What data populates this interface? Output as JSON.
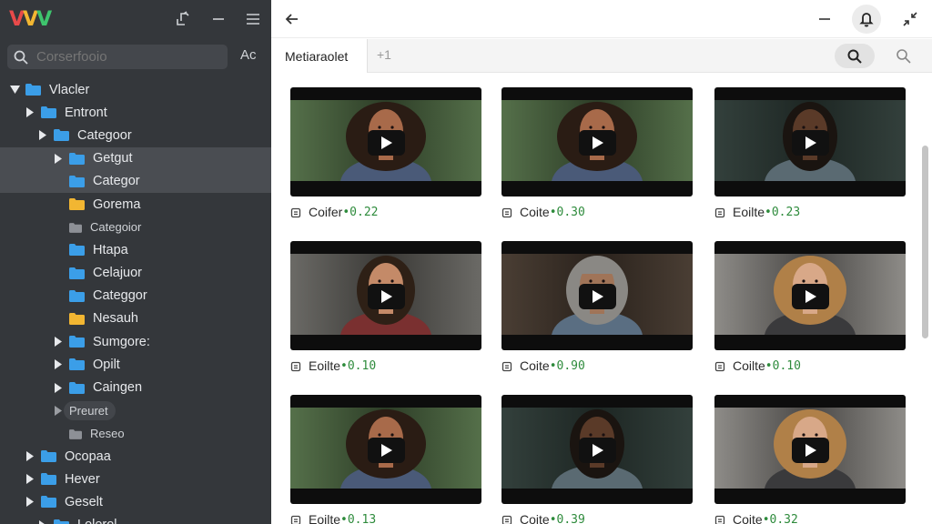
{
  "sidebar": {
    "logo": "VVV",
    "search": {
      "placeholder": "Corserfooio"
    },
    "case_toggle": "Ac",
    "tree": [
      {
        "label": "Vlacler",
        "level": 0,
        "caret": "down",
        "folder": "blue"
      },
      {
        "label": "Entront",
        "level": 1,
        "caret": "right",
        "folder": "blue"
      },
      {
        "label": "Categoor",
        "level": 2,
        "caret": "right",
        "folder": "blue"
      },
      {
        "label": "Getgut",
        "level": 3,
        "caret": "right",
        "folder": "blue",
        "selected": true
      },
      {
        "label": "Categor",
        "level": 3,
        "caret": "none",
        "folder": "blue",
        "selected": true
      },
      {
        "label": "Gorema",
        "level": 3,
        "caret": "none",
        "folder": "yellow"
      },
      {
        "label": "Categoior",
        "level": 3,
        "caret": "none",
        "folder": "gray",
        "small": true
      },
      {
        "label": "Htapa",
        "level": 3,
        "caret": "none",
        "folder": "blue"
      },
      {
        "label": "Celajuor",
        "level": 3,
        "caret": "none",
        "folder": "blue"
      },
      {
        "label": "Categgor",
        "level": 3,
        "caret": "none",
        "folder": "blue"
      },
      {
        "label": "Nesauh",
        "level": 3,
        "caret": "none",
        "folder": "yellow"
      },
      {
        "label": "Sumgore:",
        "level": 3,
        "caret": "right",
        "folder": "blue"
      },
      {
        "label": "Opilt",
        "level": 3,
        "caret": "right",
        "folder": "blue"
      },
      {
        "label": "Caingen",
        "level": 3,
        "caret": "right",
        "folder": "blue"
      },
      {
        "label": "Preuret",
        "level": 3,
        "caret": "right-gray",
        "folder": "none",
        "small": true,
        "pill": true
      },
      {
        "label": "Reseo",
        "level": 3,
        "caret": "none",
        "folder": "gray",
        "small": true
      },
      {
        "label": "Ocopaa",
        "level": 1,
        "caret": "right",
        "folder": "blue"
      },
      {
        "label": "Hever",
        "level": 1,
        "caret": "right",
        "folder": "blue"
      },
      {
        "label": "Geselt",
        "level": 1,
        "caret": "right",
        "folder": "blue"
      },
      {
        "label": "Lolerol",
        "level": 2,
        "caret": "right",
        "folder": "blue"
      }
    ]
  },
  "main": {
    "tab": {
      "label": "Metiaraolet",
      "add_label": "+1"
    },
    "icons": {
      "back": "arrow-left-icon",
      "minimize": "minus-icon",
      "notifications": "bell-icon",
      "collapse": "collapse-arrows-icon",
      "search": "search-icon",
      "person": "person-icon"
    },
    "videos": [
      {
        "label": "Coifer",
        "value": "0.22",
        "scene": "curly-woman"
      },
      {
        "label": "Coite",
        "value": "0.30",
        "scene": "curly-woman"
      },
      {
        "label": "Eoilte",
        "value": "0.23",
        "scene": "bearded-man-dark"
      },
      {
        "label": "Eoilte",
        "value": "0.10",
        "scene": "young-man"
      },
      {
        "label": "Coite",
        "value": "0.90",
        "scene": "beanie-man"
      },
      {
        "label": "Coilte",
        "value": "0.10",
        "scene": "blonde-woman"
      },
      {
        "label": "Eoilte",
        "value": "0.13",
        "scene": "curly-woman"
      },
      {
        "label": "Coite",
        "value": "0.39",
        "scene": "bearded-man-dark"
      },
      {
        "label": "Coite",
        "value": "0.32",
        "scene": "blonde-woman"
      }
    ]
  },
  "colors": {
    "sidebar_bg": "#34373b",
    "folder_blue": "#3b9ee8",
    "folder_yellow": "#f2b632",
    "score_green": "#2e8b3c"
  }
}
